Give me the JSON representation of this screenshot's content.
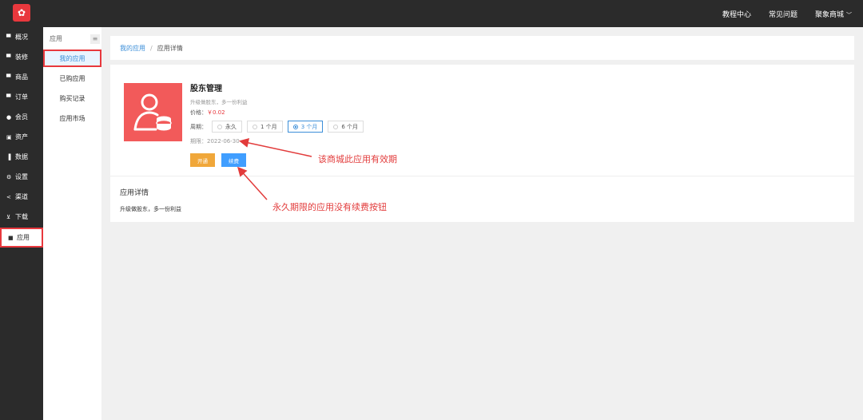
{
  "topbar": {
    "nav": [
      "教程中心",
      "常见问题"
    ],
    "shop_name": "聚象商城",
    "caret": "﹀"
  },
  "sidebar": {
    "items": [
      {
        "icon": "monitor-icon",
        "glyph": "▀",
        "label": "概况"
      },
      {
        "icon": "decor-icon",
        "glyph": "▀",
        "label": "装修"
      },
      {
        "icon": "goods-icon",
        "glyph": "▀",
        "label": "商品"
      },
      {
        "icon": "order-icon",
        "glyph": "▀",
        "label": "订单"
      },
      {
        "icon": "user-icon",
        "glyph": "●",
        "label": "会员"
      },
      {
        "icon": "asset-icon",
        "glyph": "▣",
        "label": "资产"
      },
      {
        "icon": "chart-icon",
        "glyph": "▐",
        "label": "数据"
      },
      {
        "icon": "gear-icon",
        "glyph": "⚙",
        "label": "设置"
      },
      {
        "icon": "share-icon",
        "glyph": "<",
        "label": "渠道"
      },
      {
        "icon": "download-icon",
        "glyph": "⊻",
        "label": "下载"
      },
      {
        "icon": "app-icon",
        "glyph": "■",
        "label": "应用"
      }
    ]
  },
  "subnav": {
    "header": "应用",
    "menu_glyph": "≡",
    "items": [
      "我的应用",
      "已购应用",
      "购买记录",
      "应用市场"
    ]
  },
  "breadcrumb": {
    "parent": "我的应用",
    "separator": "/",
    "current": "应用详情"
  },
  "app": {
    "title": "股东管理",
    "desc": "升级做股东，多一份利益",
    "price_label": "价格：",
    "price": "￥0.02",
    "period_label": "周期：",
    "periods": [
      "永久",
      "1 个月",
      "3 个月",
      "6 个月"
    ],
    "selected_period": "3 个月",
    "expire": "期限：2022-06-30",
    "open_label": "开通",
    "renew_label": "续费"
  },
  "details": {
    "title": "应用详情",
    "text": "升级做股东，多一份利益"
  },
  "annotations": {
    "a1": "该商城此应用有效期",
    "a2": "永久期限的应用没有续费按钮"
  },
  "colors": {
    "accent": "#e8383d",
    "link": "#3b8ed8",
    "open_button": "#f0a73a",
    "renew_button": "#409eff"
  }
}
